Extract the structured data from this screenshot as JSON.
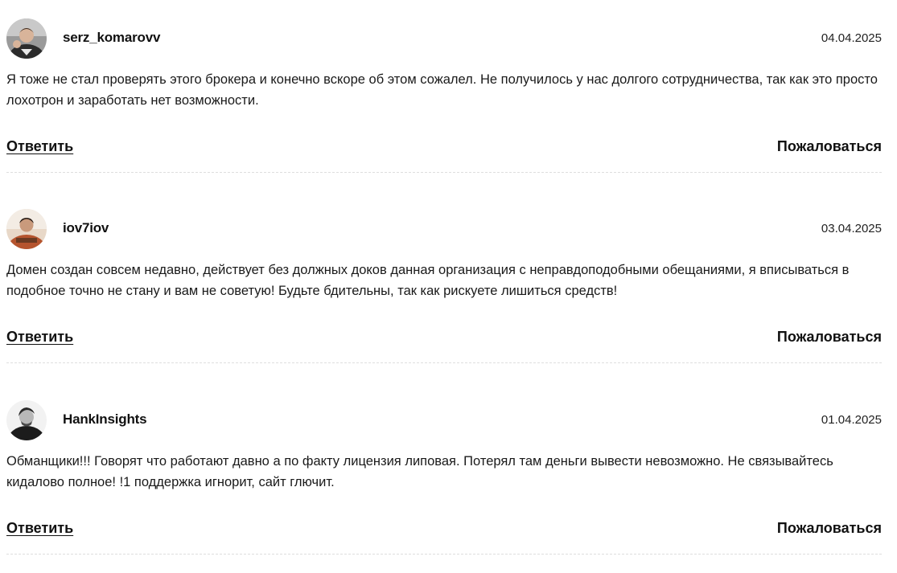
{
  "comments": [
    {
      "author": "serz_komarovv",
      "date": "04.04.2025",
      "text": "Я тоже не стал проверять этого брокера и конечно вскоре об этом сожалел. Не получилось у нас долгого сотрудничества, так как это просто лохотрон и заработать нет возможности.",
      "reply_label": "Ответить",
      "report_label": "Пожаловаться"
    },
    {
      "author": "iov7iov",
      "date": "03.04.2025",
      "text": "Домен создан совсем недавно, действует без должных доков данная организация с неправдоподобными обещаниями, я вписываться в подобное точно не стану и вам не советую! Будьте бдительны, так как рискуете лишиться средств!",
      "reply_label": "Ответить",
      "report_label": "Пожаловаться"
    },
    {
      "author": "HankInsights",
      "date": "01.04.2025",
      "text": "Обманщики!!! Говорят что работают давно а по факту лицензия липовая. Потерял там деньги вывести невозможно. Не связывайтесь кидалово полное! !1 поддержка игнорит, сайт глючит.",
      "reply_label": "Ответить",
      "report_label": "Пожаловаться"
    }
  ]
}
